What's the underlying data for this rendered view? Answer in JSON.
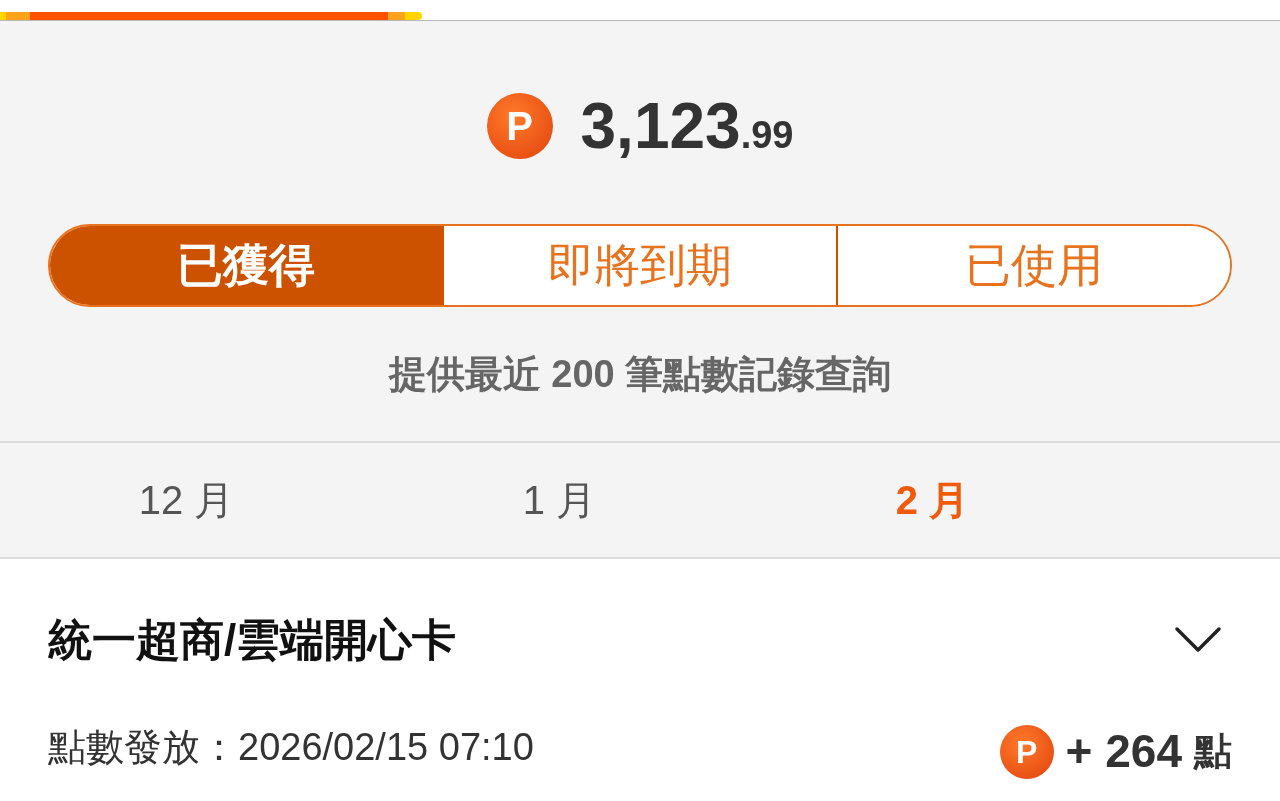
{
  "loading_bar": {
    "level": 0.33
  },
  "balance": {
    "whole": "3,123",
    "fraction": ".99",
    "icon_letter": "P"
  },
  "tabs": [
    {
      "label": "已獲得",
      "selected": true
    },
    {
      "label": "即將到期",
      "selected": false
    },
    {
      "label": "已使用",
      "selected": false
    }
  ],
  "notice": "提供最近 200 筆點數記錄查詢",
  "months": [
    {
      "label": "12 月",
      "selected": false
    },
    {
      "label": "1 月",
      "selected": false
    },
    {
      "label": "2 月",
      "selected": true
    }
  ],
  "records": [
    {
      "title": "統一超商/雲端開心卡",
      "expanded": false,
      "date": "點數發放：2026/02/15 07:10",
      "icon_letter": "P",
      "amount": "+ 264",
      "unit": "點"
    }
  ]
}
